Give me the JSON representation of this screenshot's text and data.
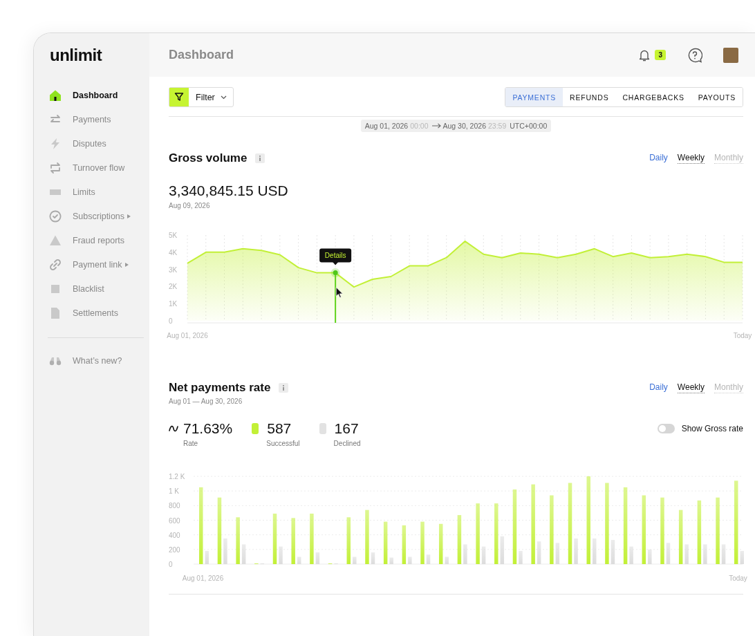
{
  "sidebar": {
    "logo": "unlimit",
    "items": [
      {
        "label": "Dashboard",
        "selected": true,
        "submenu": false
      },
      {
        "label": "Payments",
        "selected": false,
        "submenu": false
      },
      {
        "label": "Disputes",
        "selected": false,
        "submenu": false
      },
      {
        "label": "Turnover flow",
        "selected": false,
        "submenu": false
      },
      {
        "label": "Limits",
        "selected": false,
        "submenu": false
      },
      {
        "label": "Subscriptions",
        "selected": false,
        "submenu": true
      },
      {
        "label": "Fraud reports",
        "selected": false,
        "submenu": false
      },
      {
        "label": "Payment link",
        "selected": false,
        "submenu": true
      },
      {
        "label": "Blacklist",
        "selected": false,
        "submenu": false
      },
      {
        "label": "Settlements",
        "selected": false,
        "submenu": false
      }
    ],
    "footer_items": [
      {
        "label": "What’s new?"
      }
    ]
  },
  "header": {
    "title": "Dashboard",
    "notifications_badge": "3"
  },
  "toolbar": {
    "filter_label": "Filter",
    "tabs": [
      {
        "label": "PAYMENTS",
        "selected": true
      },
      {
        "label": "REFUNDS",
        "selected": false
      },
      {
        "label": "CHARGEBACKS",
        "selected": false
      },
      {
        "label": "PAYOUTS",
        "selected": false
      }
    ]
  },
  "date_range": {
    "start_date": "Aug 01, 2026",
    "start_time": "00:00",
    "end_date": "Aug 30, 2026",
    "end_time": "23:59",
    "timezone": "UTC+00:00"
  },
  "gross_volume": {
    "title": "Gross volume",
    "periods": [
      {
        "label": "Daily",
        "selected": false,
        "disabled": false
      },
      {
        "label": "Weekly",
        "selected": true,
        "disabled": false
      },
      {
        "label": "Monthly",
        "selected": false,
        "disabled": true
      }
    ],
    "amount": "3,340,845.15 USD",
    "date": "Aug 09, 2026",
    "chart_data": {
      "type": "area",
      "series": [
        {
          "color": "#c2f037",
          "values": [
            3350,
            4000,
            4000,
            4200,
            4100,
            3850,
            3100,
            2800,
            2800,
            1970,
            2420,
            2580,
            3200,
            3200,
            3680,
            4640,
            3880,
            3680,
            3950,
            3880,
            3680,
            3880,
            4200,
            3740,
            3950,
            3680,
            3740,
            3880,
            3740,
            3410,
            3410
          ]
        }
      ],
      "ylim": [
        0,
        5000
      ],
      "yticks": [
        {
          "value": 0,
          "label": "0"
        },
        {
          "value": 1000,
          "label": "1K"
        },
        {
          "value": 2000,
          "label": "2K"
        },
        {
          "value": 3000,
          "label": "3K"
        },
        {
          "value": 4000,
          "label": "4K"
        },
        {
          "value": 5000,
          "label": "5K"
        }
      ],
      "grid": true,
      "categories": [
        "Aug 01, 2026",
        null,
        null,
        null,
        null,
        null,
        null,
        null,
        null,
        null,
        null,
        null,
        null,
        null,
        null,
        null,
        null,
        null,
        null,
        null,
        null,
        null,
        null,
        null,
        null,
        null,
        null,
        null,
        null,
        null,
        "Today"
      ],
      "annotations": [
        "Details"
      ]
    }
  },
  "net_payments_rate": {
    "title": "Net payments rate",
    "subtitle": "Aug 01 — Aug 30, 2026",
    "periods": [
      {
        "label": "Daily",
        "selected": false,
        "disabled": false
      },
      {
        "label": "Weekly",
        "selected": true,
        "disabled": false
      },
      {
        "label": "Monthly",
        "selected": false,
        "disabled": true
      }
    ],
    "stats": [
      {
        "kind": "rate",
        "value": "71.63%",
        "label": "Rate"
      },
      {
        "kind": "count",
        "value": "587",
        "label": "Successful",
        "color": "#c2f037"
      },
      {
        "kind": "count",
        "value": "167",
        "label": "Declined",
        "color": "#e2e2e2"
      }
    ],
    "gross_rate_toggle": {
      "label": "Show Gross rate",
      "on": false
    },
    "chart_data": {
      "type": "bar",
      "series": [
        {
          "color": "#c2f037",
          "values": [
            1050,
            910,
            640,
            10,
            690,
            630,
            690,
            10,
            640,
            740,
            580,
            530,
            580,
            550,
            670,
            830,
            830,
            1020,
            1090,
            940,
            1110,
            1200,
            1110,
            1050,
            940,
            910,
            740,
            870,
            910,
            1140
          ]
        },
        {
          "color": "#dcdcdc",
          "values": [
            180,
            350,
            270,
            10,
            240,
            100,
            160,
            10,
            100,
            160,
            90,
            100,
            130,
            100,
            270,
            240,
            380,
            180,
            310,
            290,
            350,
            350,
            330,
            240,
            200,
            290,
            270,
            270,
            270,
            180
          ]
        }
      ],
      "grid": true,
      "stacked": false,
      "categories": [
        "Aug 01, 2026",
        null,
        null,
        null,
        null,
        null,
        null,
        null,
        null,
        null,
        null,
        null,
        null,
        null,
        null,
        null,
        null,
        null,
        null,
        null,
        null,
        null,
        null,
        null,
        null,
        null,
        null,
        null,
        null,
        "Today"
      ],
      "ylim": [
        0,
        1200
      ],
      "yticks": [
        {
          "value": 0,
          "label": "0"
        },
        {
          "value": 200,
          "label": "200"
        },
        {
          "value": 400,
          "label": "400"
        },
        {
          "value": 600,
          "label": "600"
        },
        {
          "value": 800,
          "label": "800"
        },
        {
          "value": 1000,
          "label": "1 K"
        },
        {
          "value": 1200,
          "label": "1.2 K"
        }
      ]
    }
  }
}
